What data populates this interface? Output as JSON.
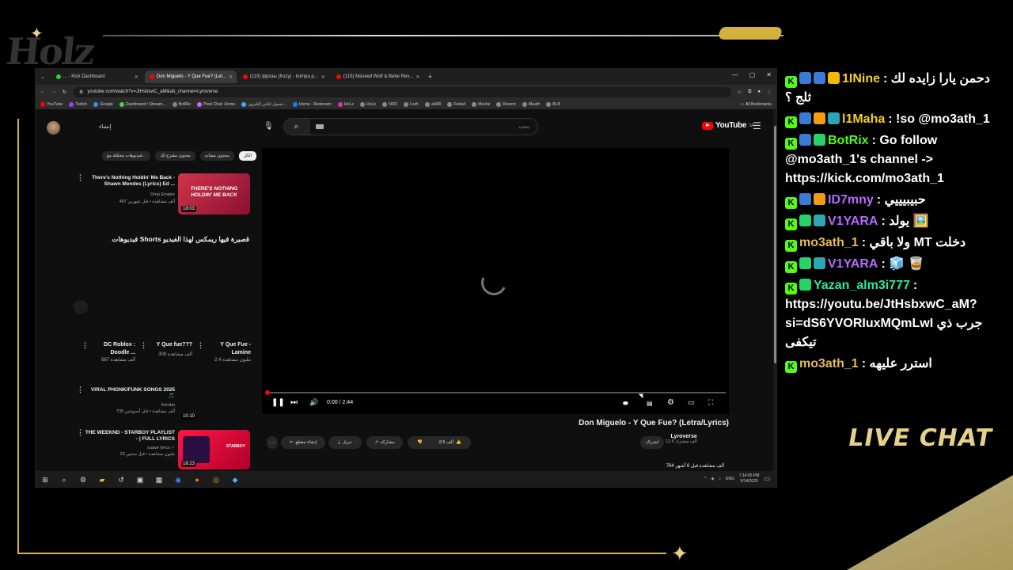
{
  "overlay": {
    "logo_text": "Holz",
    "live_chat_label": "LIVE CHAT"
  },
  "browser": {
    "tabs": [
      {
        "label": "... - Kick Dashboard",
        "active": false
      },
      {
        "label": "Don Miguelo - Y Que Fue? (Let...",
        "active": true
      },
      {
        "label": "(115) фрозы (frozy) - kompa p...",
        "active": false
      },
      {
        "label": "(115) Masked Wolf & Bebe Rex...",
        "active": false
      }
    ],
    "new_tab": "+",
    "url": "youtube.com/watch?v=JtHsbxwC_aM&ab_channel=Lyroverse",
    "bookmarks": [
      "YouTube",
      "Twitch",
      "Google",
      "Dashboard / Stream...",
      "BotRix",
      "Pixel Chat: Home",
      "تحميل اغاني الكترون...",
      "Home - Restream",
      "HoLz",
      "HoLz",
      "NFR",
      "Lozh",
      "ak90l",
      "Fahad",
      "Meshz",
      "Rwerm",
      "Muath",
      "BL8"
    ],
    "all_bookmarks": "All Bookmarks"
  },
  "youtube": {
    "create_label": "إنشاء",
    "search_placeholder": "بحث",
    "logo_text": "YouTube",
    "logo_region": "SA",
    "chips": [
      "الكل",
      "محتوى مشابه",
      "محتوى مقترح لك",
      "فيديوهات محمّلة مؤ..."
    ],
    "sidebar_videos": [
      {
        "title": "There's Nothing Holdin' Me Back - Shawn Mendes (Lyrics) Ed ...",
        "channel": "Drop Empire",
        "meta": "487 ألف مشاهدة • قبل شهرين",
        "duration": "18:03",
        "thumb_text": "THERE'S NOTHING HOLDIN' ME BACK"
      },
      {
        "title": "VIRAL PHONK/FUNK SONGS 2025 🎵",
        "channel": "Krimbo",
        "meta": "739 ألف مشاهدة • قبل أسبوعين",
        "duration": "10:10",
        "thumb_text": ""
      },
      {
        "title": "THE WEEKND - STARBOY PLAYLIST - | FULL LYRICS",
        "channel": "suave lyrics ✓",
        "meta": "23 مليون مشاهدة • قبل سنتين",
        "duration": "18:23",
        "thumb_text": "STARBOY"
      }
    ],
    "shorts_title": "فيديوهات Shorts قصيرة فيها ريمكس لهذا الفيديو",
    "shorts": [
      {
        "title": "Y Que Fue - Lamine",
        "views": "2.4 مليون مشاهدة"
      },
      {
        "title": "Y Que fue???",
        "views": "308 ألف مشاهدة"
      },
      {
        "title": "DC Roblox : Doodle ...",
        "views": "687 ألف مشاهدة"
      }
    ],
    "player": {
      "time": "0:00 / 2:44",
      "progress": 0
    },
    "video_title": "Don Miguelo - Y Que Fue? (Letra/Lyrics)",
    "channel_name": "Lyroverse",
    "channel_subs": "12.6 ألف مشترك",
    "subscribe_label": "اشتراك",
    "likes": "8.5 ألف",
    "share_label": "مشاركة",
    "download_label": "تنزيل",
    "clip_label": "إنشاء مقطع",
    "more_label": "···",
    "views_line": "764 ألف مشاهدة قبل 6 أشهر"
  },
  "taskbar": {
    "lang": "ENG",
    "time": "7:14:05 PM",
    "date": "9/14/2025"
  },
  "chat": [
    {
      "user": "1INine",
      "color": "#f4d020",
      "badges": [
        "k",
        "blue",
        "blue",
        "crown"
      ],
      "text": ": دحمن يارا زايده لك ثلج ؟"
    },
    {
      "user": "l1Maha",
      "color": "#f4d020",
      "badges": [
        "k",
        "blue",
        "orange",
        "teal"
      ],
      "text": ": !so @mo3ath_1"
    },
    {
      "user": "BotRix",
      "color": "#53fc18",
      "badges": [
        "k",
        "blue",
        "green"
      ],
      "text": ": Go follow @mo3ath_1's channel -> https://kick.com/mo3ath_1"
    },
    {
      "user": "ID7mny",
      "color": "#b36bff",
      "badges": [
        "k",
        "blue",
        "orange"
      ],
      "text": ": حبيبيييي"
    },
    {
      "user": "V1YARA",
      "color": "#b36bff",
      "badges": [
        "k",
        "green",
        "teal"
      ],
      "text": ": يولد 🖼️"
    },
    {
      "user": "mo3ath_1",
      "color": "#e6b95a",
      "badges": [
        "k"
      ],
      "text": ": ولا باقي MT دخلت"
    },
    {
      "user": "V1YARA",
      "color": "#b36bff",
      "badges": [
        "k",
        "green",
        "teal"
      ],
      "text": ": 🧊 🥃"
    },
    {
      "user": "Yazan_alm3i777",
      "color": "#2ee8a0",
      "badges": [
        "k",
        "green"
      ],
      "text": ": https://youtu.be/JtHsbxwC_aM?si=dS6YVORIuxMQmLwI جرب ذي تيكفى"
    },
    {
      "user": "mo3ath_1",
      "color": "#e6b95a",
      "badges": [
        "k"
      ],
      "text": ": استرر عليهه"
    }
  ],
  "colors": {
    "accent_gold": "#d8b640",
    "yt_red": "#ff0000",
    "kick_green": "#53fc18"
  }
}
